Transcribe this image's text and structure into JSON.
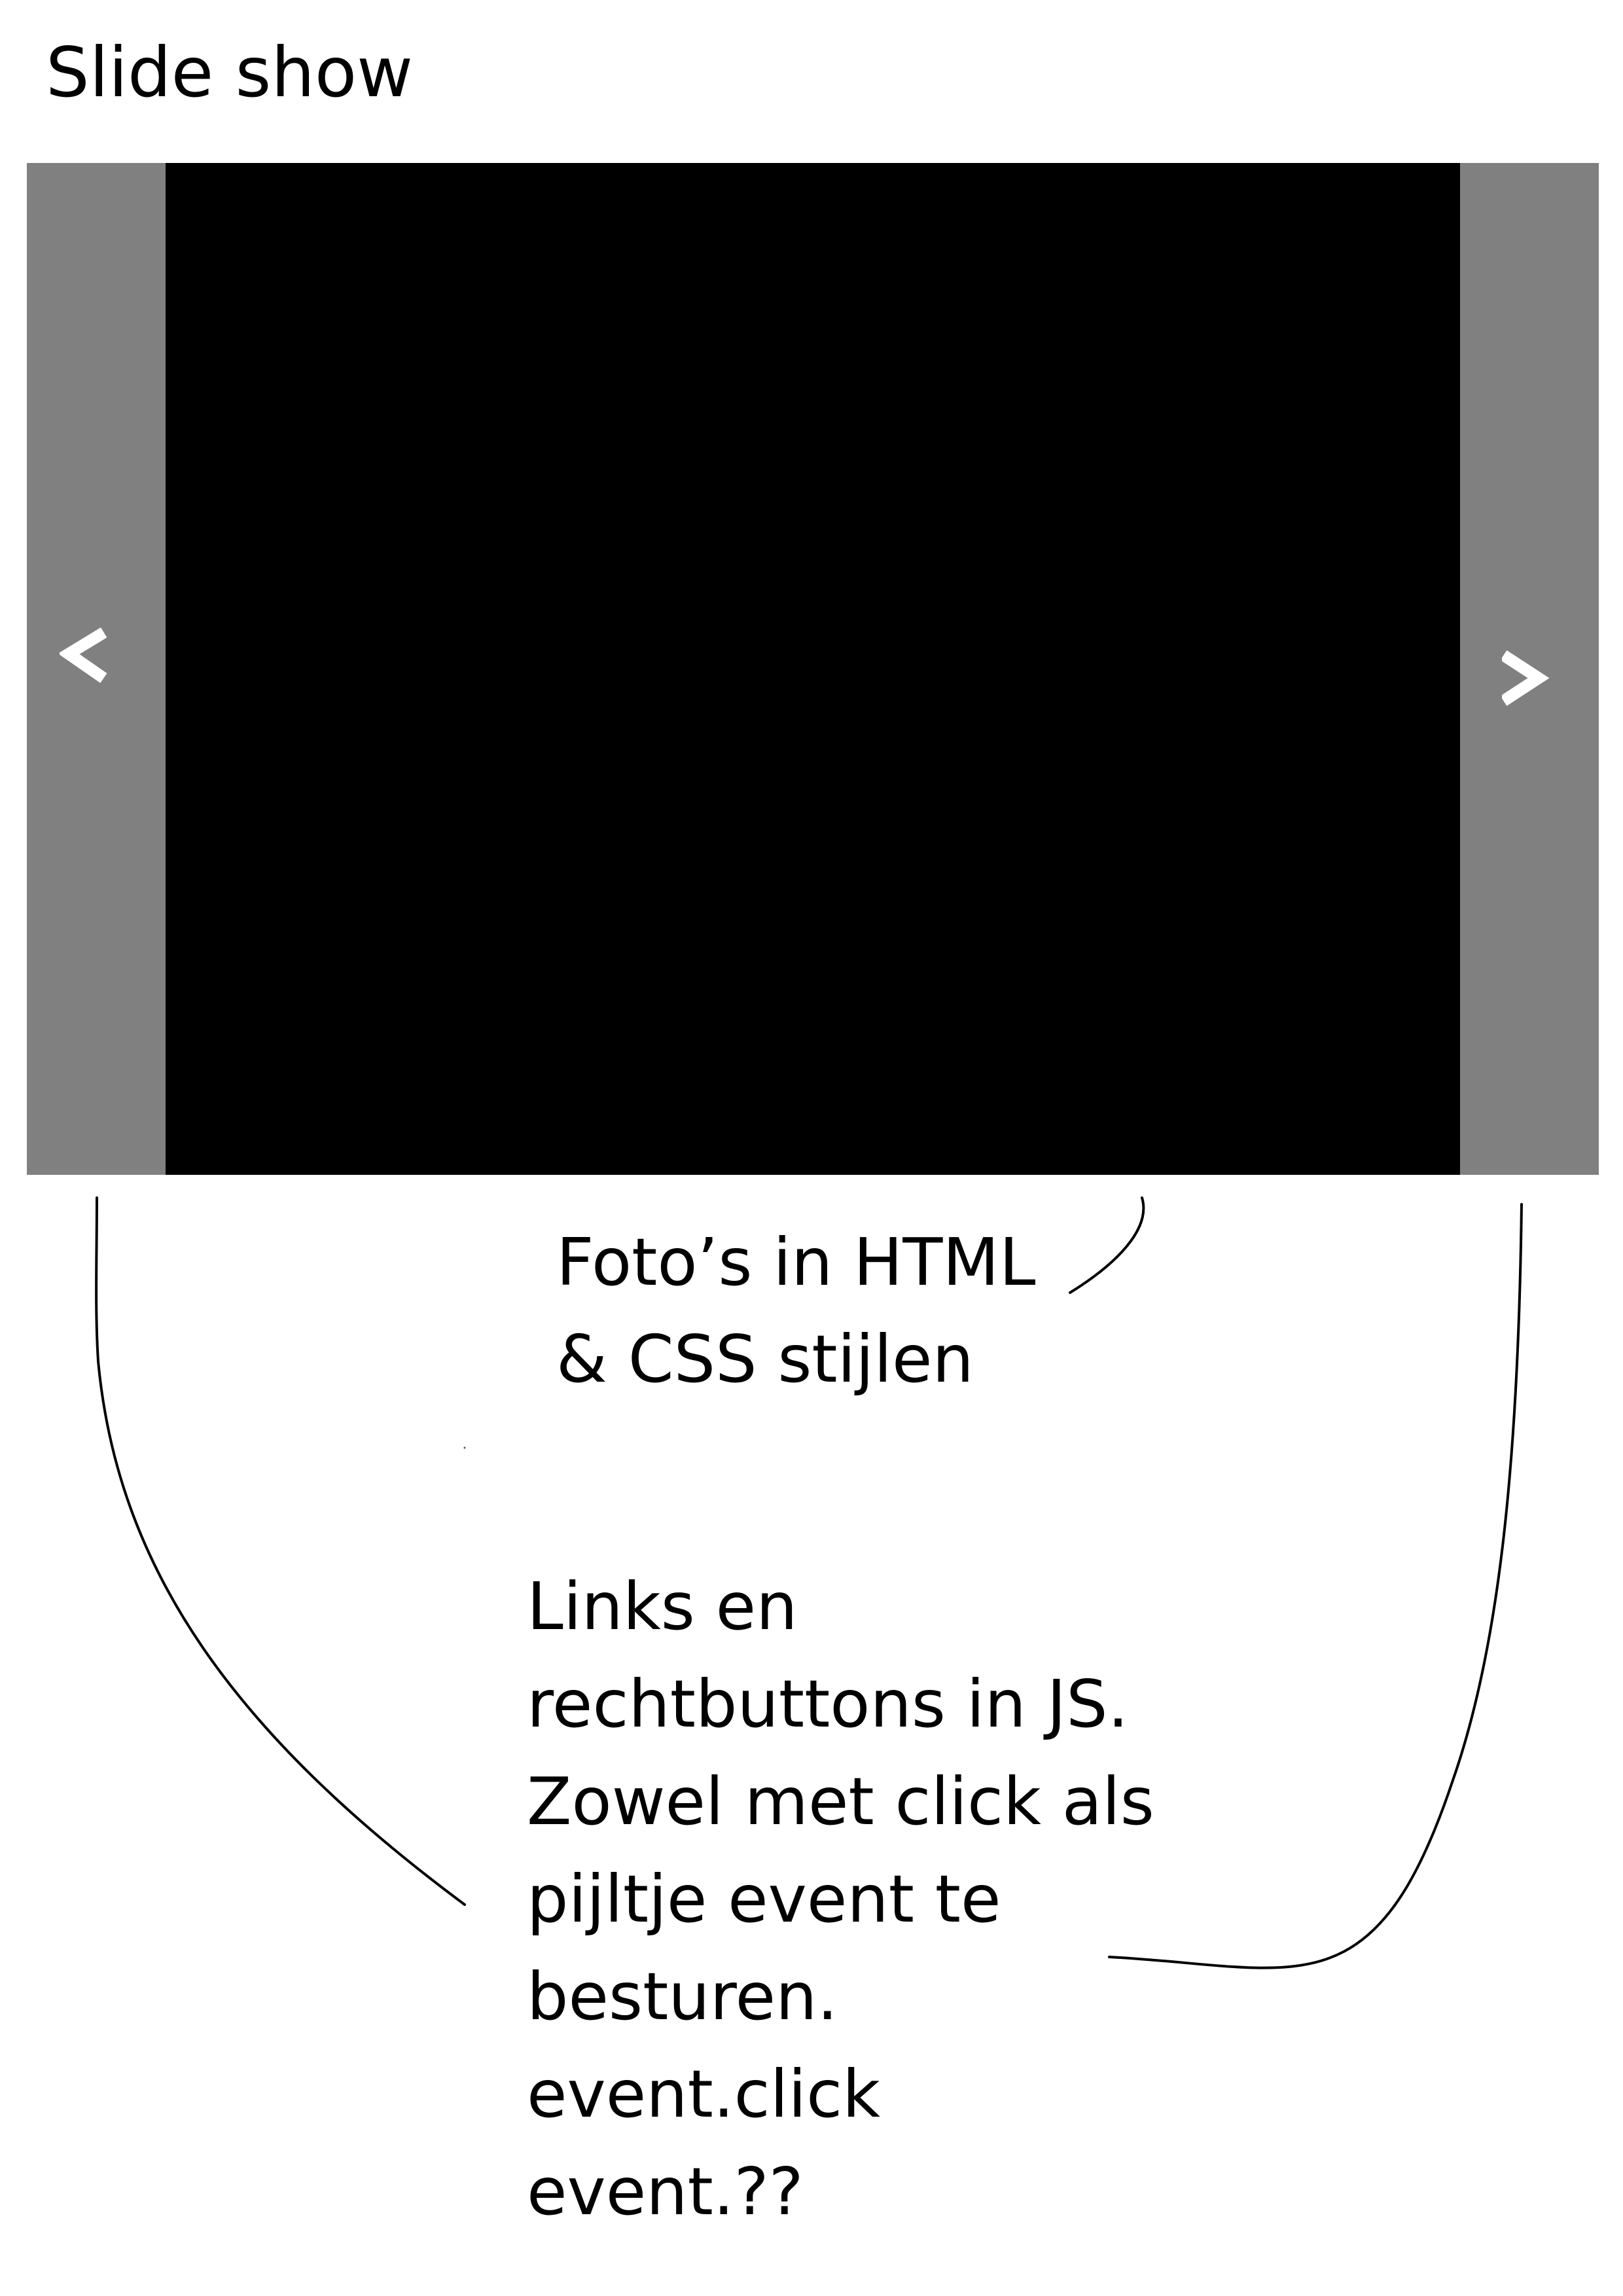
{
  "page": {
    "title": "Slide show"
  },
  "slideshow": {
    "prev_icon": "chevron-left-icon",
    "next_icon": "chevron-right-icon",
    "panel_color": "#808080",
    "photo_color": "#000000",
    "icon_color": "#ffffff"
  },
  "notes": {
    "photos": {
      "lines": [
        "Foto’s in HTML",
        "& CSS stijlen"
      ]
    },
    "js": {
      "lines": [
        "Links en",
        "rechtbuttons in JS.",
        "Zowel met click als",
        "pijltje event te",
        "besturen.",
        "event.click",
        "event.??"
      ]
    }
  }
}
